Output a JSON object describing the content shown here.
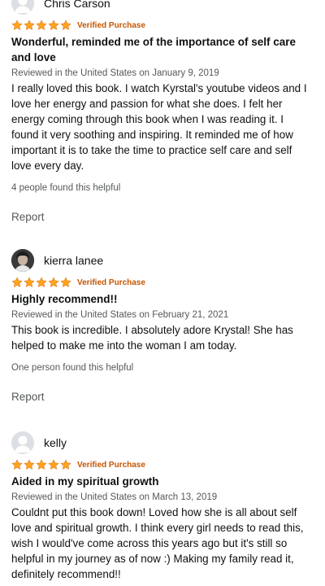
{
  "reviews": [
    {
      "author": "Chris Carson",
      "rating": 5,
      "badge": "Verified Purchase",
      "title": "Wonderful, reminded me of the importance of self care and love",
      "meta": "Reviewed in the United States on January 9, 2019",
      "body": "I really loved this book. I watch Kyrstal's youtube videos and I love her energy and passion for what she does. I felt her energy coming through this book when I was reading it. I found it very soothing and inspiring. It reminded me of how important it is to take the time to practice self care and self love every day.",
      "helpful": "4 people found this helpful",
      "report": "Report",
      "avatar": "default-avatar-icon"
    },
    {
      "author": "kierra lanee",
      "rating": 5,
      "badge": "Verified Purchase",
      "title": "Highly recommend!!",
      "meta": "Reviewed in the United States on February 21, 2021",
      "body": "This book is incredible. I absolutely adore Krystal! She has helped to make me into the woman I am today.",
      "helpful": "One person found this helpful",
      "report": "Report",
      "avatar": "user-photo-avatar"
    },
    {
      "author": "kelly",
      "rating": 5,
      "badge": "Verified Purchase",
      "title": "Aided in my spiritual growth",
      "meta": "Reviewed in the United States on March 13, 2019",
      "body": "Couldnt put this book down! Loved how she is all about self love and spiritual growth. I think every girl needs to read this, wish I would've come across this years ago but it's still so helpful in my journey as of now :) Making my family read it, definitely recommend!!",
      "avatar": "default-avatar-icon"
    }
  ],
  "colors": {
    "star": "#ffa41c",
    "badge": "#c45500",
    "muted": "#565959"
  }
}
